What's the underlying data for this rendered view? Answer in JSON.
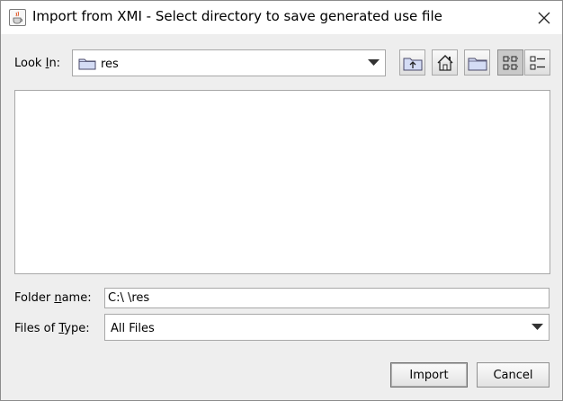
{
  "window": {
    "title": "Import from XMI - Select directory to save generated use file"
  },
  "icons": {
    "app": "java-cup-icon",
    "close": "close-icon",
    "folder": "folder-icon",
    "up_folder": "up-one-level-icon",
    "home": "home-icon",
    "new_folder": "new-folder-icon",
    "list_view": "list-view-icon",
    "details_view": "details-view-icon",
    "dropdown": "chevron-down-icon"
  },
  "look_in": {
    "label_prefix": "Look ",
    "label_mnemonic": "I",
    "label_suffix": "n:",
    "value": "res"
  },
  "folder_name": {
    "label_prefix": "Folder ",
    "label_mnemonic": "n",
    "label_suffix": "ame:",
    "value": "C:\\                                        \\res"
  },
  "files_of_type": {
    "label_prefix": "Files of ",
    "label_mnemonic": "T",
    "label_suffix": "ype:",
    "value": "All Files"
  },
  "buttons": {
    "import": "Import",
    "cancel": "Cancel"
  }
}
